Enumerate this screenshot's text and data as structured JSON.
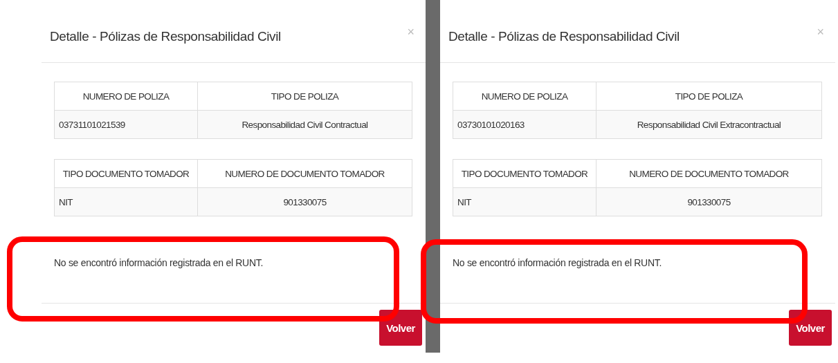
{
  "dialogs": [
    {
      "title": "Detalle - Pólizas de Responsabilidad Civil",
      "close": "×",
      "tables": [
        {
          "columns": [
            "NUMERO DE POLIZA",
            "TIPO DE POLIZA"
          ],
          "rows": [
            [
              "03731101021539",
              "Responsabilidad Civil Contractual"
            ]
          ]
        },
        {
          "columns": [
            "TIPO DOCUMENTO TOMADOR",
            "NUMERO DE DOCUMENTO TOMADOR"
          ],
          "rows": [
            [
              "NIT",
              "901330075"
            ]
          ]
        }
      ],
      "message": "No se encontró información registrada en el RUNT.",
      "message_highlighted": true,
      "button": "Volver"
    },
    {
      "title": "Detalle - Pólizas de Responsabilidad Civil",
      "close": "×",
      "tables": [
        {
          "columns": [
            "NUMERO DE POLIZA",
            "TIPO DE POLIZA"
          ],
          "rows": [
            [
              "03730101020163",
              "Responsabilidad Civil Extracontractual"
            ]
          ]
        },
        {
          "columns": [
            "TIPO DOCUMENTO TOMADOR",
            "NUMERO DE DOCUMENTO TOMADOR"
          ],
          "rows": [
            [
              "NIT",
              "901330075"
            ]
          ]
        }
      ],
      "message": "No se encontró información registrada en el RUNT.",
      "message_highlighted": true,
      "button": "Volver"
    }
  ]
}
